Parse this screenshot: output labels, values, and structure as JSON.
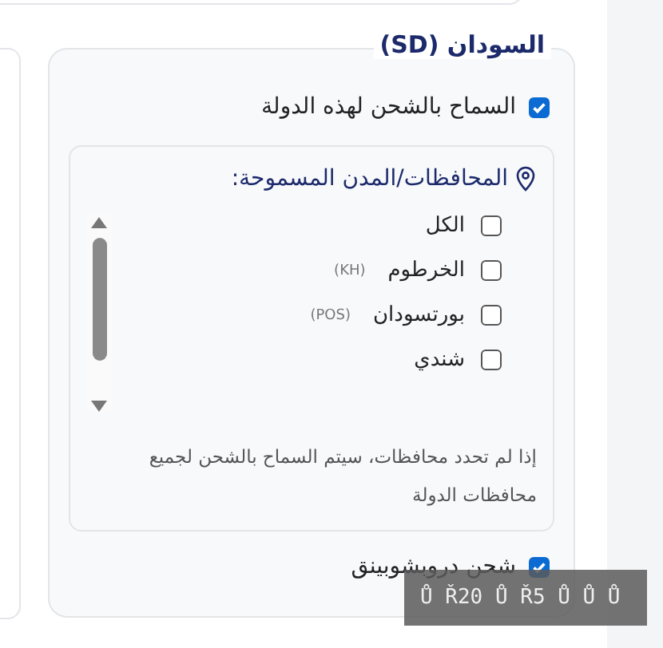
{
  "section": {
    "title": "السودان (SD)",
    "allow_shipping": {
      "label": "السماح بالشحن لهذه الدولة",
      "checked": true
    },
    "regions": {
      "heading": "المحافظات/المدن المسموحة:",
      "items": [
        {
          "label": "الكل",
          "checked": false
        },
        {
          "label": "الخرطوم",
          "code": "(KH)",
          "checked": false
        },
        {
          "label": "بورتسودان",
          "code": "(POS)",
          "checked": false
        },
        {
          "label": "شندي",
          "checked": false
        }
      ],
      "note": "إذا لم تحدد محافظات، سيتم السماح بالشحن لجميع محافظات الدولة"
    },
    "dropshipping": {
      "label": "شحن دروبشوبينق",
      "checked": true
    }
  },
  "overlay": {
    "text": "Ů Ř20 Ů Ř5 Ů Ů Ů"
  }
}
